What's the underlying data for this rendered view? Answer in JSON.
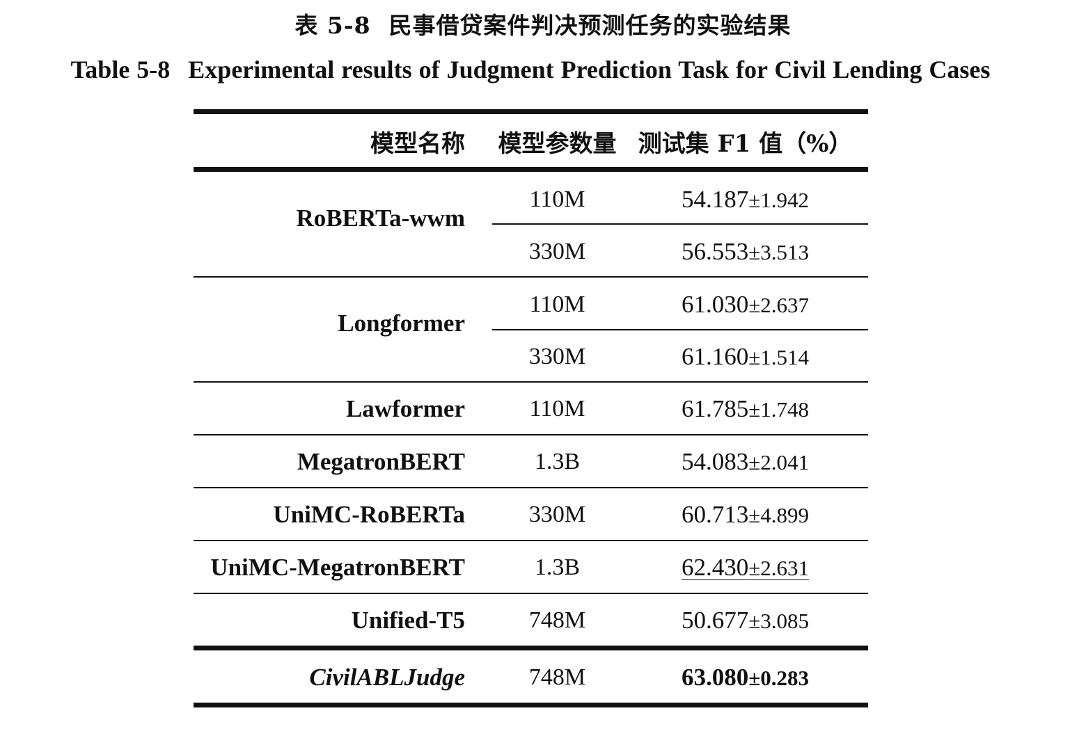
{
  "caption": {
    "cn_number": "表 5-8",
    "cn_title": "民事借贷案件判决预测任务的实验结果",
    "en_number": "Table 5-8",
    "en_title": "Experimental results of Judgment Prediction Task for Civil Lending Cases"
  },
  "table": {
    "headers": [
      "模型名称",
      "模型参数量",
      "测试集 F1 值（%）"
    ],
    "groups": [
      {
        "model": "RoBERTa-wwm",
        "rows": [
          {
            "params": "110M",
            "f1": "54.187",
            "std": "±1.942"
          },
          {
            "params": "330M",
            "f1": "56.553",
            "std": "±3.513"
          }
        ]
      },
      {
        "model": "Longformer",
        "rows": [
          {
            "params": "110M",
            "f1": "61.030",
            "std": "±2.637"
          },
          {
            "params": "330M",
            "f1": "61.160",
            "std": "±1.514"
          }
        ]
      },
      {
        "model": "Lawformer",
        "rows": [
          {
            "params": "110M",
            "f1": "61.785",
            "std": "±1.748"
          }
        ]
      },
      {
        "model": "MegatronBERT",
        "rows": [
          {
            "params": "1.3B",
            "f1": "54.083",
            "std": "±2.041"
          }
        ]
      },
      {
        "model": "UniMC-RoBERTa",
        "rows": [
          {
            "params": "330M",
            "f1": "60.713",
            "std": "±4.899"
          }
        ]
      },
      {
        "model": "UniMC-MegatronBERT",
        "rows": [
          {
            "params": "1.3B",
            "f1": "62.430",
            "std": "±2.631",
            "underlined": true
          }
        ]
      },
      {
        "model": "Unified-T5",
        "rows": [
          {
            "params": "748M",
            "f1": "50.677",
            "std": "±3.085"
          }
        ]
      },
      {
        "model": "CivilABLJudge",
        "italic": true,
        "rows": [
          {
            "params": "748M",
            "f1": "63.080",
            "std": "±0.283",
            "bold": true
          }
        ]
      }
    ]
  }
}
